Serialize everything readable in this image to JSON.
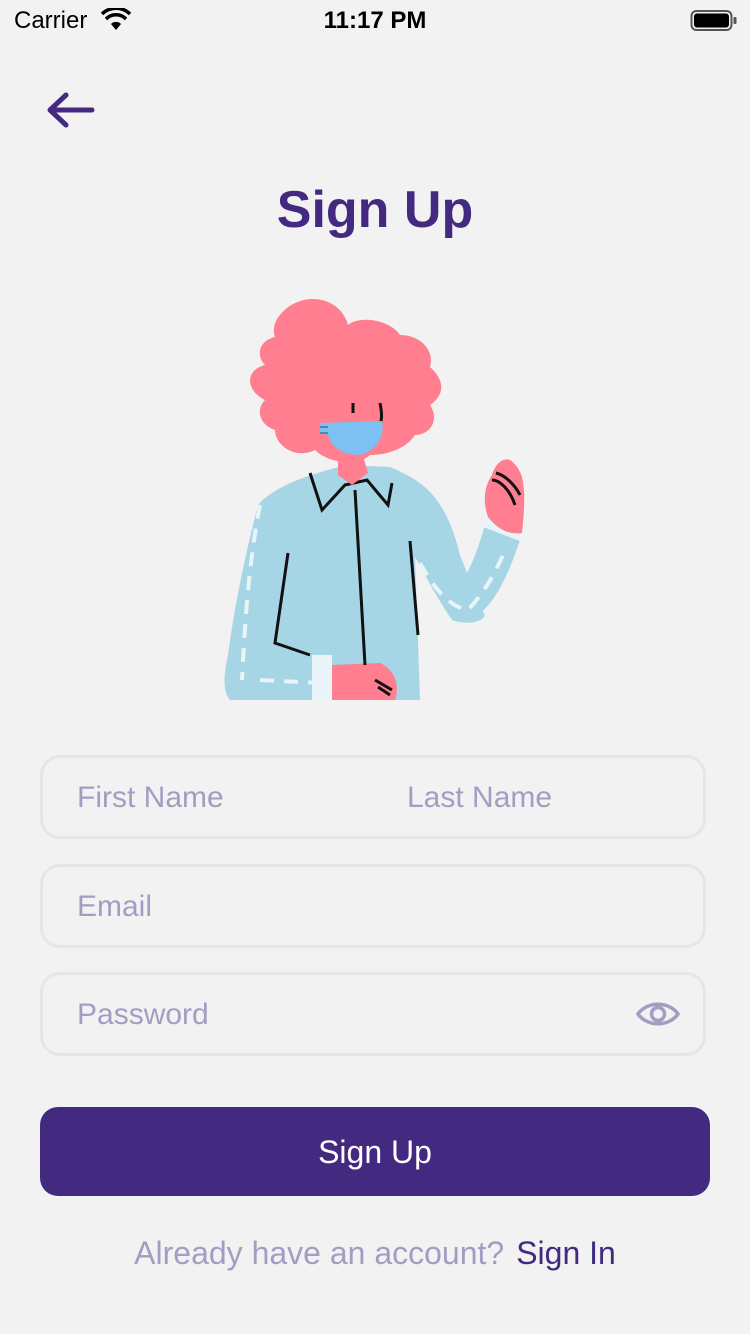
{
  "status_bar": {
    "carrier": "Carrier",
    "time": "11:17 PM"
  },
  "header": {
    "title": "Sign Up",
    "back_icon": "arrow-left-icon"
  },
  "form": {
    "first_name_placeholder": "First Name",
    "last_name_placeholder": "Last Name",
    "email_placeholder": "Email",
    "password_placeholder": "Password",
    "password_toggle_icon": "eye-icon"
  },
  "actions": {
    "signup_label": "Sign Up"
  },
  "footer": {
    "prompt": "Already have an account?",
    "signin_label": "Sign In"
  },
  "colors": {
    "brand": "#432a80",
    "placeholder": "#a39dc4",
    "background": "#f2f2f2",
    "field_border": "#e6e6e6"
  }
}
